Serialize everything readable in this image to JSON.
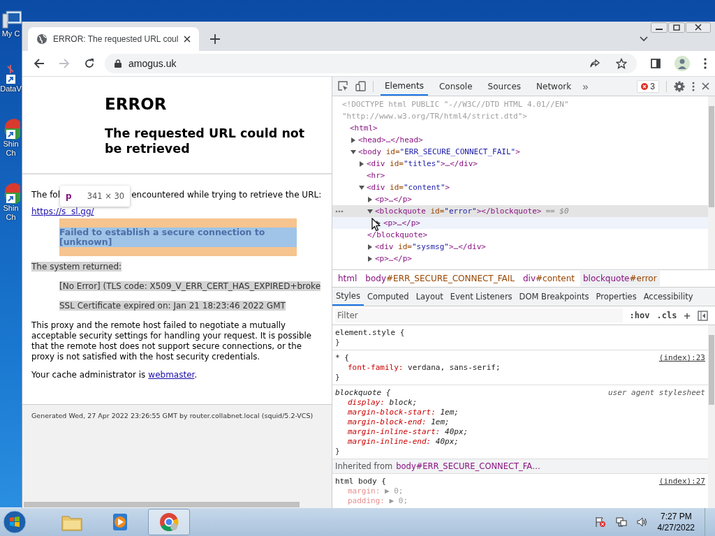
{
  "desktop_icons": [
    {
      "label": "My C",
      "kind": "computer"
    },
    {
      "label": "DataV",
      "kind": "shortcut"
    },
    {
      "label": "Shin\nCh",
      "kind": "app"
    },
    {
      "label": "Shin\nCh",
      "kind": "app"
    }
  ],
  "browser": {
    "tab_title": "ERROR: The requested URL coul",
    "address": "amogus.uk"
  },
  "page": {
    "title": "ERROR",
    "subtitle": "The requested URL could not be retrieved",
    "intro_start": "The fol",
    "intro_end": "encountered while trying to retrieve the URL:",
    "url": "https://s  sl.gg/",
    "tooltip": {
      "tag": "p",
      "size": "341 × 30"
    },
    "error": {
      "text": "Failed to establish a secure connection to [unknown]",
      "inspected": true
    },
    "system": {
      "text": "The system returned:",
      "highlighted": true
    },
    "messages": [
      {
        "text": "[No Error] (TLS code: X509_V_ERR_CERT_HAS_EXPIRED+broke",
        "highlighted": true
      },
      {
        "text": "SSL Certificate expired on: Jan 21 18:23:46 2022 GMT",
        "highlighted": true
      }
    ],
    "description": "This proxy and the remote host failed to negotiate a mutually acceptable security settings for handling your request. It is possible that the remote host does not support secure connections, or the proxy is not satisfied with the host security credentials.",
    "admin_text": "Your cache administrator is",
    "admin_link": "webmaster",
    "admin_end": ".",
    "footer": "Generated Wed, 27 Apr 2022 23:26:55 GMT by router.collabnet.local (squid/5.2-VCS)"
  },
  "devtools": {
    "tabs": [
      {
        "label": "Elements",
        "selected": true
      },
      {
        "label": "Console",
        "selected": false
      },
      {
        "label": "Sources",
        "selected": false
      },
      {
        "label": "Network",
        "selected": false
      }
    ],
    "more": "»",
    "error_count": "3",
    "dom": [
      {
        "kind": "doctype",
        "text": "<!DOCTYPE html PUBLIC \"-//W3C//DTD HTML 4.01//EN\""
      },
      {
        "kind": "doctype",
        "text": "\"http://www.w3.org/TR/html4/strict.dtd\">"
      },
      {
        "kind": "element",
        "open": "<html>",
        "selected": false,
        "hovered": false,
        "children": [
          {
            "kind": "element",
            "open": "<head>…</head>",
            "expanded": false,
            "selected": false,
            "hovered": false
          },
          {
            "kind": "element",
            "open": "<body",
            "attr": "id=",
            "value": "\"ERR_SECURE_CONNECT_FAIL\"",
            "end": ">",
            "expanded": true,
            "selected": false,
            "hovered": false,
            "children": [
              {
                "kind": "element",
                "open": "<div",
                "attr": "id=",
                "value": "\"titles\"",
                "end": ">…</div>",
                "expanded": false,
                "selected": false,
                "hovered": false
              },
              {
                "kind": "element",
                "open": "<hr>",
                "selected": false,
                "hovered": false
              },
              {
                "kind": "element",
                "open": "<div",
                "attr": "id=",
                "value": "\"content\"",
                "end": ">",
                "expanded": true,
                "selected": false,
                "hovered": false,
                "children": [
                  {
                    "kind": "element",
                    "open": "<p>…</p>",
                    "expanded": false,
                    "selected": false,
                    "hovered": false
                  },
                  {
                    "kind": "element",
                    "open": "<blockquote",
                    "attr": "id=",
                    "value": "\"error\"",
                    "end": "></blockquote>",
                    "note": "== $0",
                    "expanded": true,
                    "selected": true,
                    "hovered": false,
                    "close": "</blockquote>",
                    "children": [
                      {
                        "kind": "element",
                        "open": "<p>…</p>",
                        "expanded": false,
                        "selected": false,
                        "hovered": true
                      }
                    ]
                  },
                  {
                    "kind": "element",
                    "open": "<div",
                    "attr": "id=",
                    "value": "\"sysmsg\"",
                    "end": ">…</div>",
                    "expanded": false,
                    "selected": false,
                    "hovered": false
                  },
                  {
                    "kind": "element",
                    "open": "<p>…</p>",
                    "expanded": false,
                    "selected": false,
                    "hovered": false
                  }
                ]
              }
            ]
          }
        ]
      }
    ],
    "breadcrumbs": [
      {
        "tag": "html",
        "selected": false
      },
      {
        "tag": "body",
        "id": "#ERR_SECURE_CONNECT_FAIL",
        "selected": false
      },
      {
        "tag": "div",
        "id": "#content",
        "selected": false
      },
      {
        "tag": "blockquote",
        "id": "#error",
        "selected": true
      }
    ],
    "style_tabs": [
      {
        "label": "Styles",
        "selected": true
      },
      {
        "label": "Computed",
        "selected": false
      },
      {
        "label": "Layout",
        "selected": false
      },
      {
        "label": "Event Listeners",
        "selected": false
      },
      {
        "label": "DOM Breakpoints",
        "selected": false
      },
      {
        "label": "Properties",
        "selected": false
      },
      {
        "label": "Accessibility",
        "selected": false
      }
    ],
    "filter": {
      "placeholder": "Filter"
    },
    "hov": ":hov",
    "cls": ".cls",
    "add": "+",
    "rules": [
      {
        "kind": "rule",
        "selector": "element.style {",
        "italic": false,
        "close": "}"
      },
      {
        "kind": "rule",
        "selector": "* {",
        "source": "(index):23",
        "italic": false,
        "props": [
          {
            "name": "font-family:",
            "value": "verdana, sans-serif;",
            "faded": false
          }
        ],
        "close": "}"
      },
      {
        "kind": "rule",
        "selector": "blockquote {",
        "source": "user agent stylesheet",
        "italic": true,
        "props": [
          {
            "name": "display:",
            "value": "block;",
            "faded": false
          },
          {
            "name": "margin-block-start:",
            "value": "1em;",
            "faded": false
          },
          {
            "name": "margin-block-end:",
            "value": "1em;",
            "faded": false
          },
          {
            "name": "margin-inline-start:",
            "value": "40px;",
            "faded": false
          },
          {
            "name": "margin-inline-end:",
            "value": "40px;",
            "faded": false
          }
        ],
        "close": "}"
      },
      {
        "kind": "inherited",
        "label": "Inherited from",
        "from": "body#ERR_SECURE_CONNECT_FA…"
      },
      {
        "kind": "rule",
        "selector": "html body {",
        "source": "(index):27",
        "italic": false,
        "props": [
          {
            "name": "margin:",
            "value": "▶ 0;",
            "faded": true
          },
          {
            "name": "padding:",
            "value": "▶ 0;",
            "faded": true
          }
        ]
      }
    ]
  },
  "taskbar": {
    "time": "7:27 PM",
    "date": "4/27/2022"
  }
}
